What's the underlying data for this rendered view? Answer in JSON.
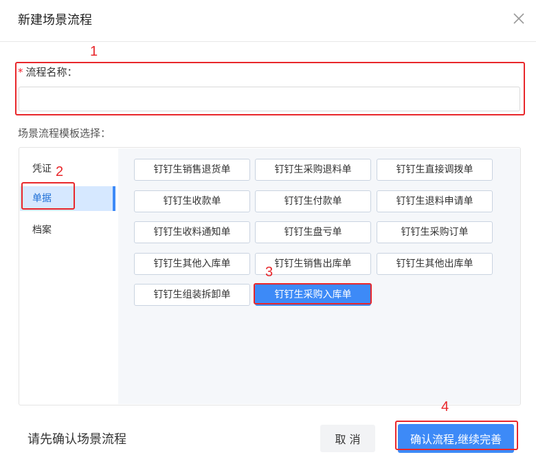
{
  "dialog": {
    "title": "新建场景流程",
    "close_icon": "close-icon"
  },
  "form": {
    "required_mark": "*",
    "name_label": "流程名称：",
    "name_value": "",
    "template_label": "场景流程模板选择："
  },
  "nav": {
    "items": [
      {
        "label": "凭证",
        "active": false
      },
      {
        "label": "单据",
        "active": true
      },
      {
        "label": "档案",
        "active": false
      }
    ]
  },
  "templates": {
    "items": [
      {
        "label": "钉钉生销售退货单",
        "selected": false
      },
      {
        "label": "钉钉生采购退料单",
        "selected": false
      },
      {
        "label": "钉钉生直接调拨单",
        "selected": false
      },
      {
        "label": "钉钉生收款单",
        "selected": false
      },
      {
        "label": "钉钉生付款单",
        "selected": false
      },
      {
        "label": "钉钉生退料申请单",
        "selected": false
      },
      {
        "label": "钉钉生收料通知单",
        "selected": false
      },
      {
        "label": "钉钉生盘亏单",
        "selected": false
      },
      {
        "label": "钉钉生采购订单",
        "selected": false
      },
      {
        "label": "钉钉生其他入库单",
        "selected": false
      },
      {
        "label": "钉钉生销售出库单",
        "selected": false
      },
      {
        "label": "钉钉生其他出库单",
        "selected": false
      },
      {
        "label": "钉钉生组装拆卸单",
        "selected": false
      },
      {
        "label": "钉钉生采购入库单",
        "selected": true
      }
    ]
  },
  "footer": {
    "hint": "请先确认场景流程",
    "cancel_label": "取 消",
    "confirm_label": "确认流程,继续完善"
  },
  "annotations": {
    "color": "#e8262a",
    "labels": [
      "1",
      "2",
      "3",
      "4"
    ]
  },
  "colors": {
    "primary": "#3d8af7",
    "active_nav_bg": "#d6e8ff",
    "template_area_bg": "#f5f7fa"
  }
}
